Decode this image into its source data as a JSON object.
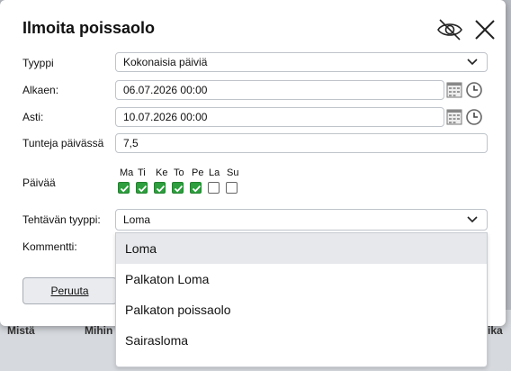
{
  "background": {
    "col1": "Mistä",
    "col2": "Mihin",
    "col3": "ika"
  },
  "dialog": {
    "title": "Ilmoita poissaolo",
    "icons": {
      "hide": "eye-off-icon",
      "close": "close-icon"
    }
  },
  "form": {
    "type": {
      "label": "Tyyppi",
      "value": "Kokonaisia päiviä"
    },
    "start": {
      "label": "Alkaen:",
      "value": "06.07.2026 00:00"
    },
    "end": {
      "label": "Asti:",
      "value": "10.07.2026 00:00"
    },
    "hours": {
      "label": "Tunteja päivässä",
      "value": "7,5"
    },
    "days": {
      "label": "Päivää",
      "items": [
        {
          "label": "Ma",
          "checked": true
        },
        {
          "label": "Ti",
          "checked": true
        },
        {
          "label": "Ke",
          "checked": true
        },
        {
          "label": "To",
          "checked": true
        },
        {
          "label": "Pe",
          "checked": true
        },
        {
          "label": "La",
          "checked": false
        },
        {
          "label": "Su",
          "checked": false
        }
      ]
    },
    "task_type": {
      "label": "Tehtävän tyyppi:",
      "value": "Loma"
    },
    "comment": {
      "label": "Kommentti:"
    },
    "cancel_label": "Peruuta"
  },
  "dropdown": {
    "options": [
      "Loma",
      "Palkaton Loma",
      "Palkaton poissaolo",
      "Sairasloma"
    ],
    "highlighted_index": 0
  },
  "colors": {
    "checkbox_checked": "#2e9e3f",
    "option_highlight": "#e6e8eb"
  }
}
